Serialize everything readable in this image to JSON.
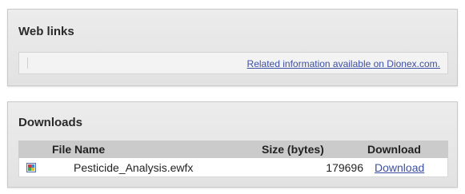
{
  "web_links": {
    "title": "Web links",
    "link_text": "Related information available on Dionex.com."
  },
  "downloads": {
    "title": "Downloads",
    "columns": [
      "File Name",
      "Size (bytes)",
      "Download"
    ],
    "rows": [
      {
        "icon": "file-icon",
        "file_name": "Pesticide_Analysis.ewfx",
        "size": "179696",
        "download": "Download"
      }
    ]
  },
  "colors": {
    "link": "#3d4fa3",
    "header_bg": "#cbcbcb",
    "panel_bg": "#e6e6e6"
  }
}
